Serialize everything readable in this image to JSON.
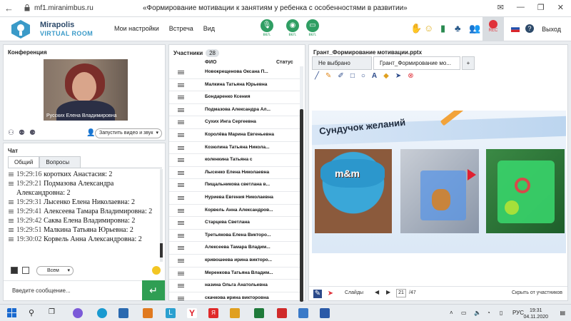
{
  "browser": {
    "url": "mf1.miranimbus.ru",
    "page_title": "«Формирование мотивации к занятиям у ребенка с особенностями в развитии»"
  },
  "header": {
    "brand": "Mirapolis",
    "brand_sub": "VIRTUAL ROOM",
    "menu": [
      "Мои настройки",
      "Встреча",
      "Вид"
    ],
    "mic_label": "вкл.",
    "cam_label": "вкл.",
    "screen_label": "вкл.",
    "rec_label": "REC",
    "exit_label": "Выход"
  },
  "conference": {
    "title": "Конференция",
    "speaker": "Русских Елена Владимировна",
    "video_select": "Запустить видео и звук"
  },
  "chat": {
    "title": "Чат",
    "tabs": [
      "Общий",
      "Вопросы"
    ],
    "messages": [
      {
        "time": "19:29:16",
        "text": "коротких Анастасия: 2"
      },
      {
        "time": "19:29:21",
        "text": "Подмазова Александра Александровна: 2"
      },
      {
        "time": "19:29:31",
        "text": "Лысенко Елена  Николаевна: 2"
      },
      {
        "time": "19:29:41",
        "text": "Алексеева  Тамара Владимировна: 2"
      },
      {
        "time": "19:29:42",
        "text": "Саква Елена Владимировна: 2"
      },
      {
        "time": "19:29:51",
        "text": "Малкина Татьяна  Юрьевна: 2"
      },
      {
        "time": "19:30:02",
        "text": "Корвель Анна  Александровна: 2"
      }
    ],
    "recipient": "Всем",
    "input_placeholder": "Введите сообщение..."
  },
  "participants": {
    "title": "Участники",
    "count": "28",
    "col_name": "ФИО",
    "col_status": "Статус",
    "list": [
      "Новокрещенова  Оксана  П...",
      "Малкина Татьяна  Юрьевна",
      "Бондаренко  Ксения",
      "Подмазова Александра  Ал...",
      "Сухих  Инга Сергеевна",
      "Королёва Марина Евгеньевна",
      "Козюлина  Татьяна Никола...",
      "коленкина Татьяна  с",
      "Лысенко Елена  Николаевна",
      "Пищальникова  светлана в...",
      "Нуриева Евгения Николаевна",
      "Корвель Анна  Александров...",
      "Старцева Светлана",
      "Третьякова  Елена Викторо...",
      "Алексеева  Тамара  Владим...",
      "кривошеева  ирина  викторо...",
      "Меренкова  Татьяна  Владим...",
      "назина  Ольга Анатольевна",
      "скачкова ирина викторовна",
      "коротких Анастасия",
      "Голубкова  Елена Сергеевна"
    ]
  },
  "presentation": {
    "title": "Грант_Формирование мотивации.pptx",
    "tabs": [
      "Не выбрано",
      "Грант_Формирование мо...",
      "+"
    ],
    "slide_title": "Сундучок желаний",
    "slide_logo_text": "m&m",
    "slides_label": "Слайды",
    "current_page": "21",
    "total_pages": "/47",
    "hide_label": "Скрыть от участников"
  },
  "taskbar": {
    "lang": "РУС",
    "time": "19:31",
    "date": "04.11.2020"
  },
  "colors": {
    "accent_green": "#2f9e63",
    "rec_red": "#e0323a",
    "brand_blue": "#3a9ac8"
  }
}
